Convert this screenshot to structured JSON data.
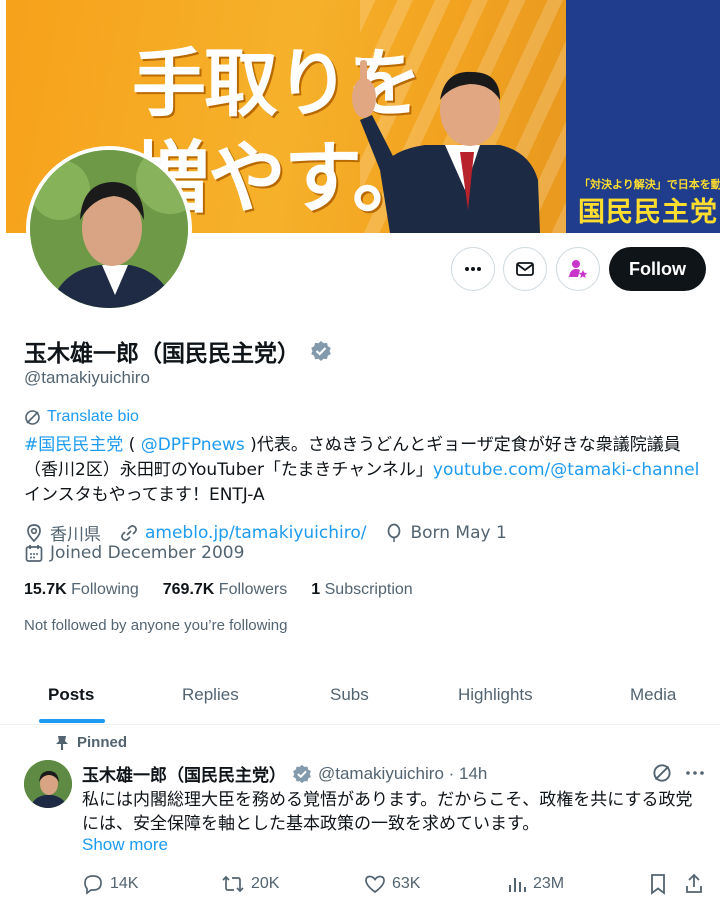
{
  "banner": {
    "slogan_line1": "手取りを",
    "slogan_line2": "増やす。",
    "party_tagline": "「対決より解決」で日本を動かす",
    "party_name": "国民民主党"
  },
  "actions": {
    "follow_label": "Follow"
  },
  "profile": {
    "name": "玉木雄一郎（国民民主党）",
    "handle": "@tamakiyuichiro",
    "translate_label": "Translate bio",
    "bio": {
      "hashtag": "#国民民主党",
      "paren_open": " ( ",
      "mention": "@DPFPnews",
      "text1": " )代表。さぬきうどんとギョーザ定食が好きな衆議院議員（香川2区）永田町のYouTuber「たまきチャンネル」",
      "link": "youtube.com/@tamaki-channel",
      "text2": " インスタもやってます！ENTJ-A"
    },
    "location": "香川県",
    "website": "ameblo.jp/tamakiyuichiro/",
    "born": "Born May 1",
    "joined": "Joined December 2009",
    "following_count": "15.7K",
    "following_label": "Following",
    "followers_count": "769.7K",
    "followers_label": "Followers",
    "subscription_count": "1",
    "subscription_label": "Subscription",
    "not_followed": "Not followed by anyone you’re following"
  },
  "tabs": [
    "Posts",
    "Replies",
    "Subs",
    "Highlights",
    "Media"
  ],
  "post": {
    "pinned_label": "Pinned",
    "author_name": "玉木雄一郎（国民民主党）",
    "author_handle": "@tamakiyuichiro · 14h",
    "text": "私には内閣総理大臣を務める覚悟があります。だからこそ、政権を共にする政党には、安全保障を軸とした基本政策の一致を求めています。",
    "show_more": "Show more",
    "replies": "14K",
    "reposts": "20K",
    "likes": "63K",
    "views": "23M"
  },
  "colors": {
    "accent": "#1d9bf0",
    "verified": "#829aab",
    "subscribe": "#c936c9",
    "banner_orange": "#f6a21f",
    "banner_blue": "#1f3d8c",
    "banner_yellow": "#ffdd2e"
  }
}
